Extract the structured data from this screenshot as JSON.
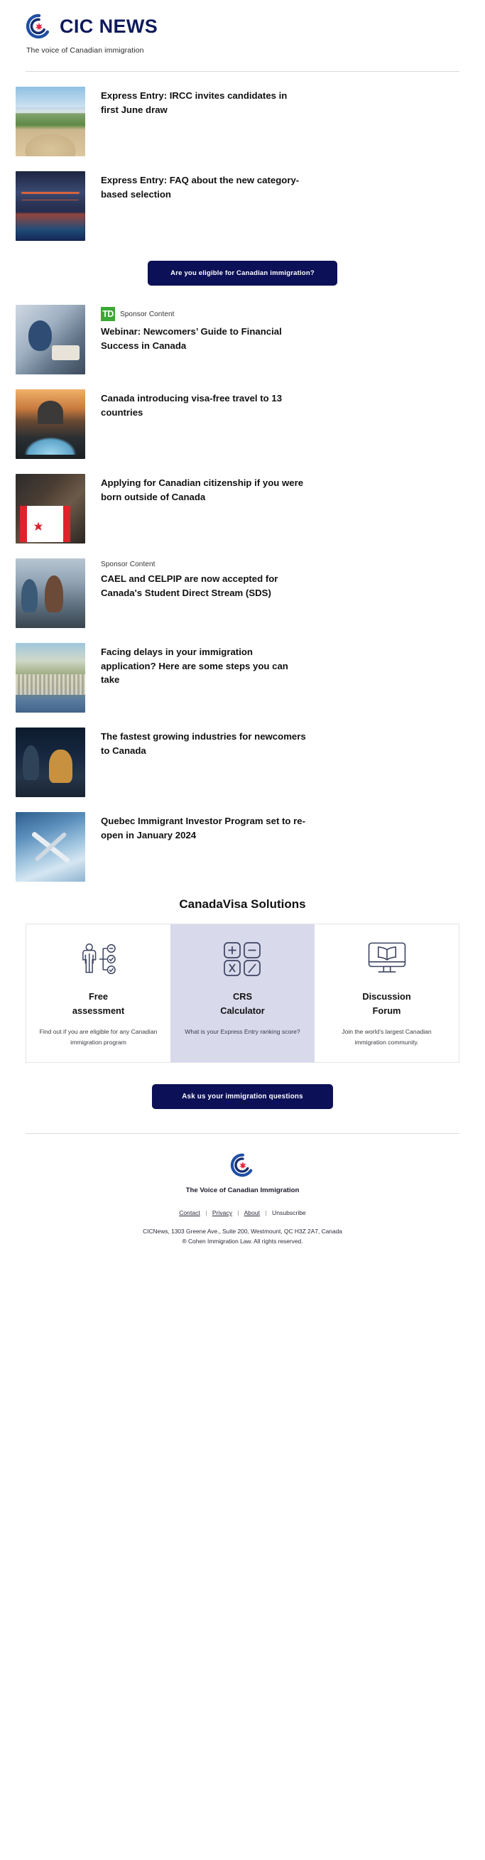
{
  "header": {
    "brand_name": "CIC NEWS",
    "tagline": "The voice of Canadian immigration",
    "logo_icon": "cic-news-logo-icon"
  },
  "articles": [
    {
      "title": "Express Entry: IRCC invites candidates in first June draw",
      "kicker": "",
      "sponsor_logo": "",
      "thumb_class": "t-dunes",
      "thumb_name": "article-thumbnail-dunes"
    },
    {
      "title": "Express Entry: FAQ about the new category-based selection",
      "kicker": "",
      "sponsor_logo": "",
      "thumb_class": "t-bridge",
      "thumb_name": "article-thumbnail-bridge"
    },
    {
      "title": "Webinar: Newcomers’ Guide to Financial Success in Canada",
      "kicker": "Sponsor Content",
      "sponsor_logo": "TD",
      "thumb_class": "t-webinar",
      "thumb_name": "article-thumbnail-webinar"
    },
    {
      "title": "Canada introducing visa-free travel to 13 countries",
      "kicker": "",
      "sponsor_logo": "",
      "thumb_class": "t-fountain",
      "thumb_name": "article-thumbnail-fountain"
    },
    {
      "title": "Applying for Canadian citizenship if you were born outside of Canada",
      "kicker": "",
      "sponsor_logo": "",
      "thumb_class": "t-flag",
      "thumb_name": "article-thumbnail-flag"
    },
    {
      "title": "CAEL and CELPIP are now accepted for Canada's Student Direct Stream (SDS)",
      "kicker": "Sponsor Content",
      "sponsor_logo": "",
      "thumb_class": "t-students",
      "thumb_name": "article-thumbnail-students"
    },
    {
      "title": "Facing delays in your immigration application? Here are some steps you can take",
      "kicker": "",
      "sponsor_logo": "",
      "thumb_class": "t-city",
      "thumb_name": "article-thumbnail-city"
    },
    {
      "title": "The fastest growing industries for newcomers to Canada",
      "kicker": "",
      "sponsor_logo": "",
      "thumb_class": "t-office",
      "thumb_name": "article-thumbnail-office"
    },
    {
      "title": "Quebec Immigrant Investor Program set to re-open in January 2024",
      "kicker": "",
      "sponsor_logo": "",
      "thumb_class": "t-plane",
      "thumb_name": "article-thumbnail-plane"
    }
  ],
  "cta_primary": {
    "label": "Are you eligible for Canadian immigration?"
  },
  "cta_secondary": {
    "label": "Ask us your immigration questions"
  },
  "solutions": {
    "title": "CanadaVisa Solutions",
    "cards": [
      {
        "name": "Free\nassessment",
        "name_line1": "Free",
        "name_line2": "assessment",
        "desc": "Find out if you are eligible for any Canadian immigration program",
        "icon": "assessment-checklist-icon",
        "highlight": false
      },
      {
        "name_line1": "CRS",
        "name_line2": "Calculator",
        "desc": "What is your Express Entry ranking score?",
        "icon": "calculator-icon",
        "highlight": true
      },
      {
        "name_line1": "Discussion",
        "name_line2": "Forum",
        "desc": "Join the world’s largest Canadian immigration community.",
        "icon": "monitor-book-icon",
        "highlight": false
      }
    ]
  },
  "footer": {
    "logo_icon": "cic-news-mark-icon",
    "tagline": "The Voice of Canadian Immigration",
    "links": [
      {
        "label": "Contact",
        "underline": true
      },
      {
        "label": "Privacy",
        "underline": true
      },
      {
        "label": "About",
        "underline": true
      },
      {
        "label": "Unsubscribe",
        "underline": false
      }
    ],
    "separator": "|",
    "address": "CICNews, 1303 Greene Ave., Suite 200, Westmount, QC H3Z 2A7, Canada",
    "copyright": "® Cohen Immigration Law. All rights reserved."
  },
  "colors": {
    "brand_navy": "#0e1a5c",
    "cta_navy": "#0c1057",
    "td_green": "#3aa935",
    "card_highlight": "#d9d9ec",
    "maple_red": "#e0232b"
  }
}
